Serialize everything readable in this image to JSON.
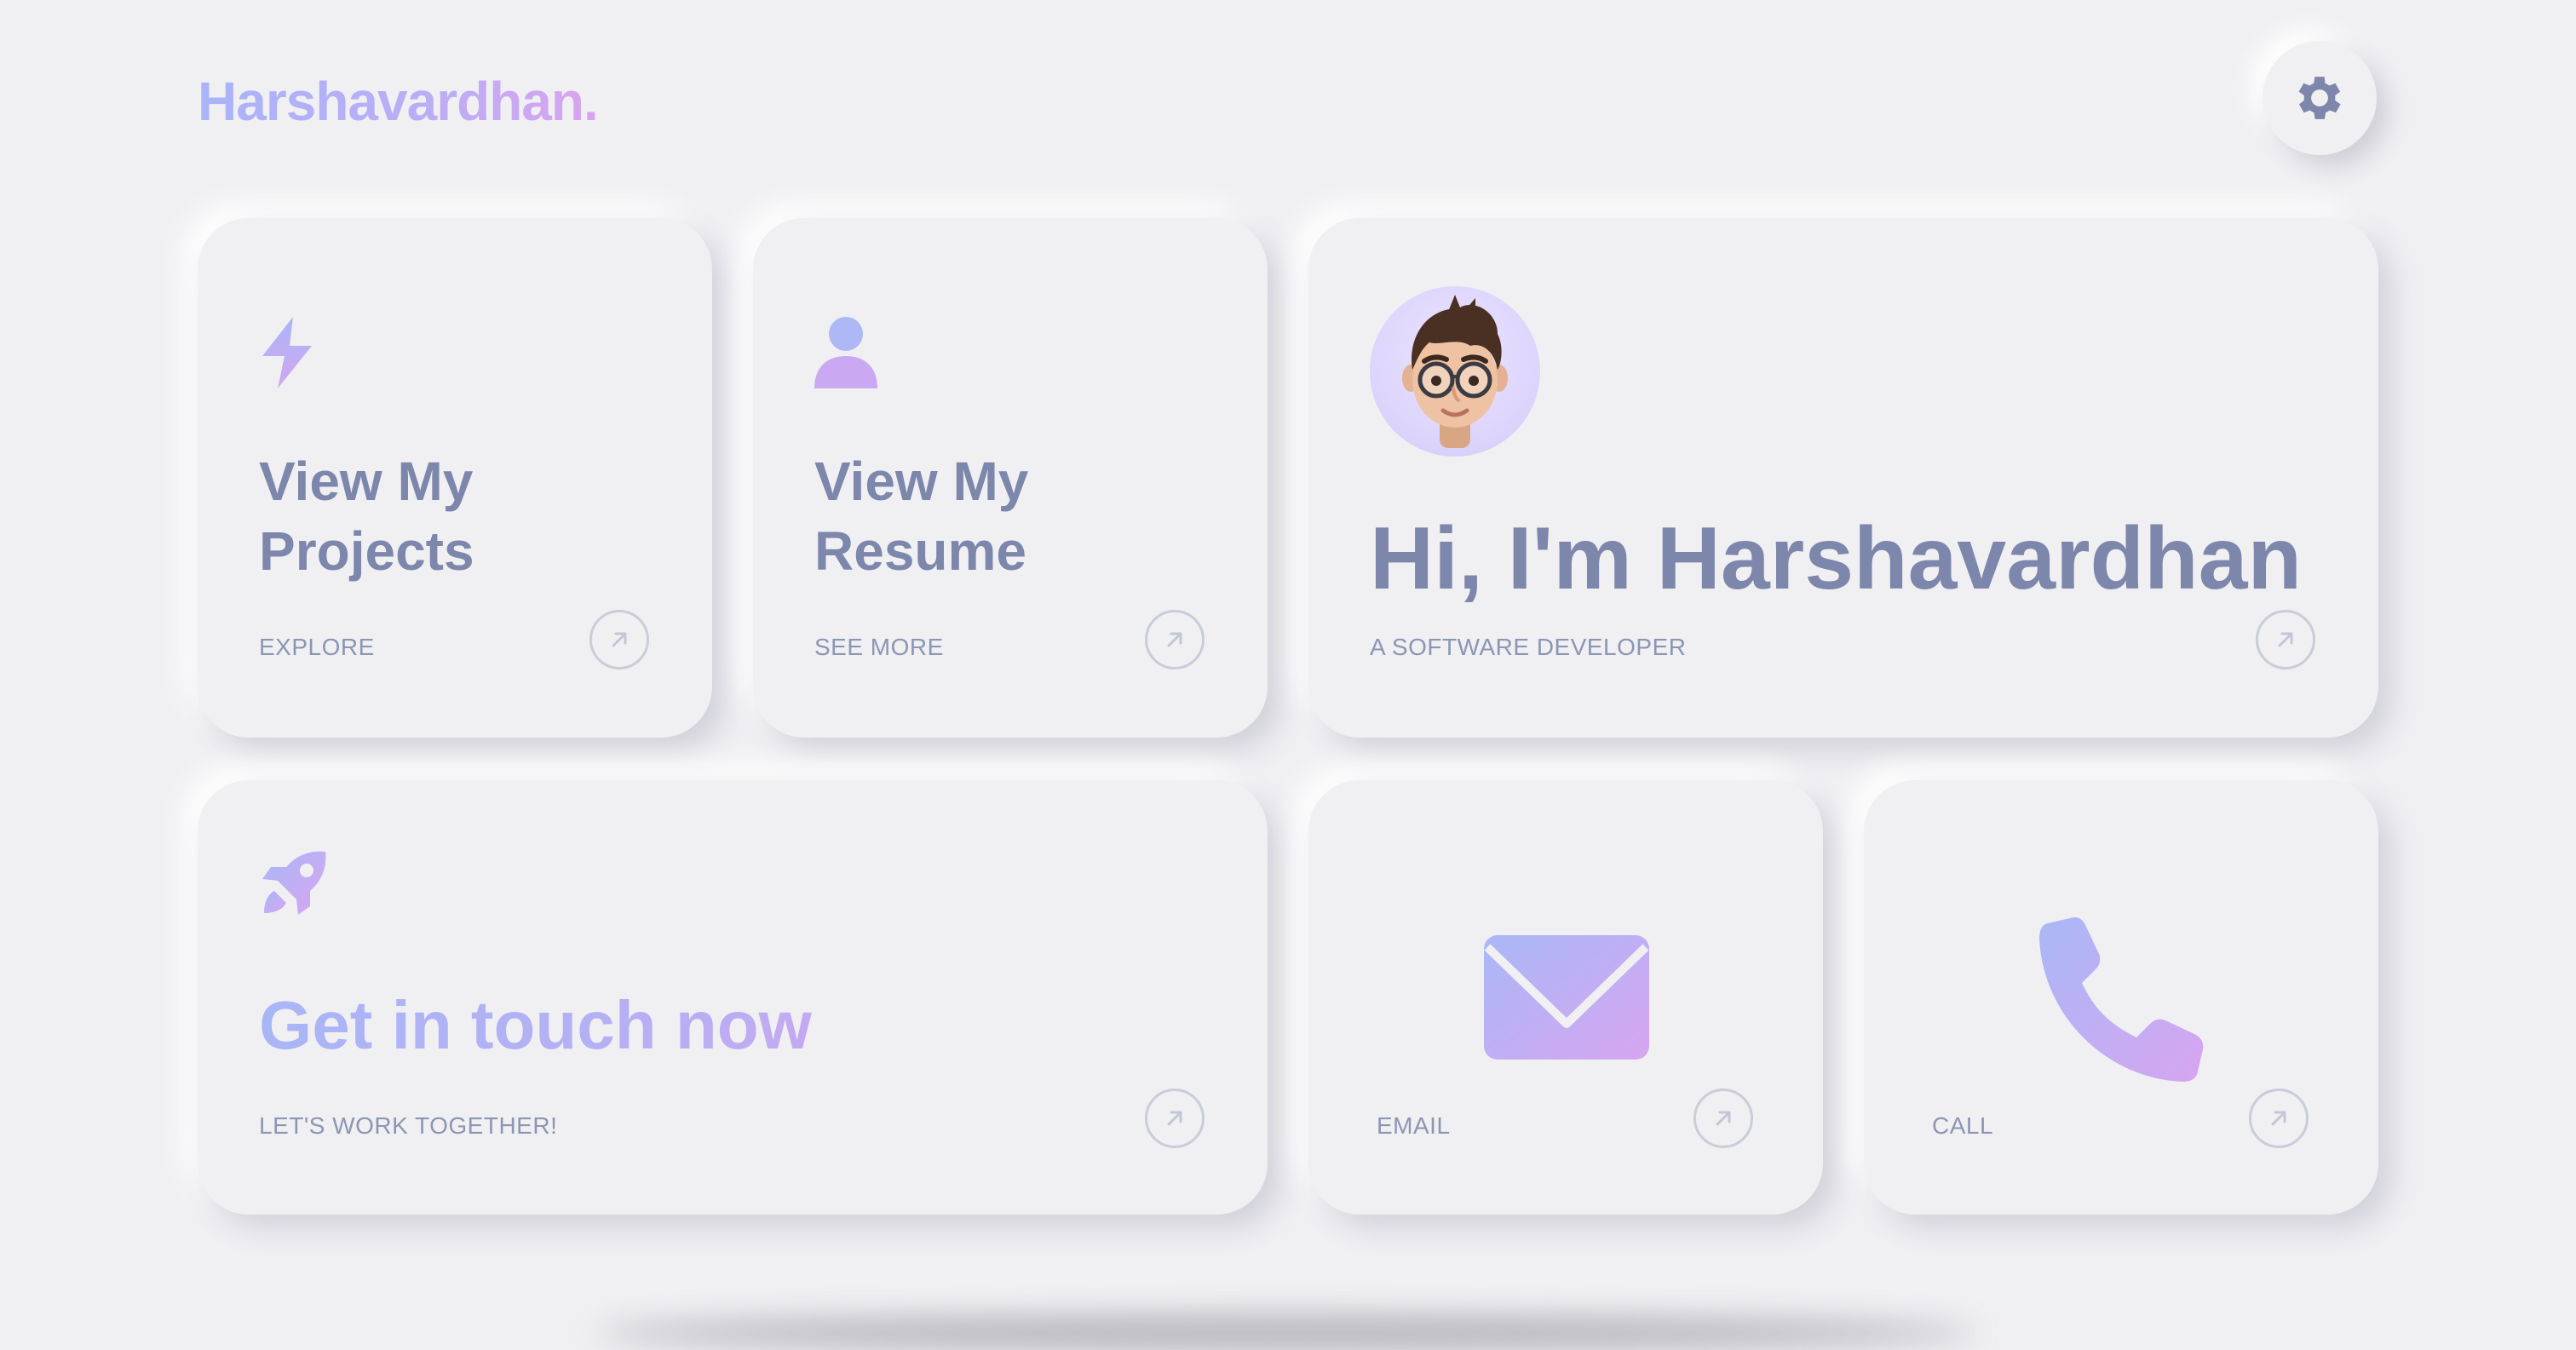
{
  "brand": {
    "logo_text": "Harshavardhan."
  },
  "header": {
    "settings_icon": "gear-icon"
  },
  "colors": {
    "background": "#f0f0f3",
    "text_primary": "#7d87ab",
    "text_secondary": "#8b96b3",
    "gradient_start": "#a9b6f6",
    "gradient_end": "#d5a6f1"
  },
  "cards": {
    "projects": {
      "icon": "lightning-icon",
      "title_line1": "View My",
      "title_line2": "Projects",
      "subtitle": "EXPLORE"
    },
    "resume": {
      "icon": "user-icon",
      "title_line1": "View My",
      "title_line2": "Resume",
      "subtitle": "SEE MORE"
    },
    "intro": {
      "avatar": "memoji-avatar",
      "title": "Hi, I'm Harshavardhan",
      "subtitle": "A SOFTWARE DEVELOPER"
    },
    "contact": {
      "icon": "rocket-icon",
      "title": "Get in touch now",
      "subtitle": "LET'S WORK TOGETHER!"
    },
    "email": {
      "icon": "mail-icon",
      "label": "EMAIL"
    },
    "call": {
      "icon": "phone-icon",
      "label": "CALL"
    }
  }
}
